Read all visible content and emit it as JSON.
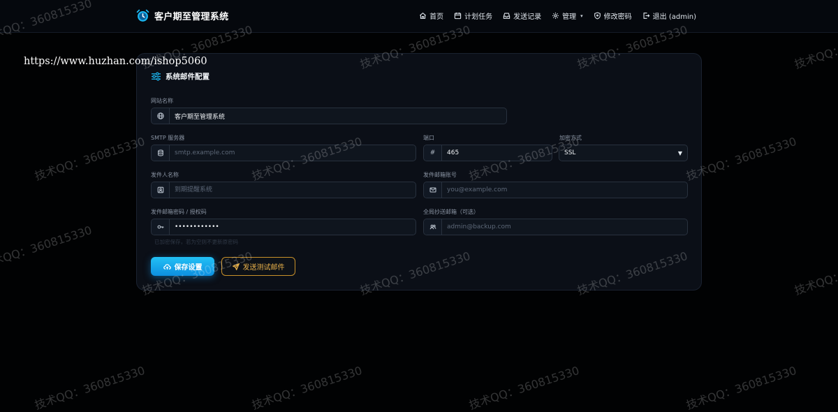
{
  "app": {
    "title": "客户期至管理系统"
  },
  "nav": {
    "items": [
      {
        "label": "首页",
        "icon": "home-icon"
      },
      {
        "label": "计划任务",
        "icon": "calendar-icon"
      },
      {
        "label": "发送记录",
        "icon": "inbox-icon"
      },
      {
        "label": "管理",
        "icon": "gear-icon",
        "caret": "▾"
      },
      {
        "label": "修改密码",
        "icon": "shield-icon"
      },
      {
        "label": "退出 (admin)",
        "icon": "logout-icon"
      }
    ]
  },
  "overlay": {
    "url": "https://www.huzhan.com/ishop5060",
    "watermark": "技术QQ：360815330"
  },
  "panel": {
    "title": "系统邮件配置",
    "site_name": {
      "label": "网站名称",
      "value": "客户期至管理系统"
    },
    "smtp_server": {
      "label": "SMTP 服务器",
      "placeholder": "smtp.example.com"
    },
    "port": {
      "label": "端口",
      "addon": "#",
      "value": "465"
    },
    "encryption": {
      "label": "加密方式",
      "value": "SSL",
      "caret": "▼"
    },
    "sender_name": {
      "label": "发件人名称",
      "placeholder": "到期提醒系统"
    },
    "sender_email": {
      "label": "发件邮箱账号",
      "placeholder": "you@example.com"
    },
    "password": {
      "label": "发件邮箱密码 / 授权码",
      "value": "••••••••••••"
    },
    "cc_email": {
      "label": "全局抄送邮箱（可选）",
      "placeholder": "admin@backup.com"
    },
    "hint": "已加密保存，若为空则不更新原密码",
    "save_label": "保存设置",
    "test_label": "发送测试邮件"
  },
  "colors": {
    "accent": "#1aa9ee",
    "warning": "#e8b14a",
    "background": "#010203",
    "panel": "#0b0f17"
  }
}
